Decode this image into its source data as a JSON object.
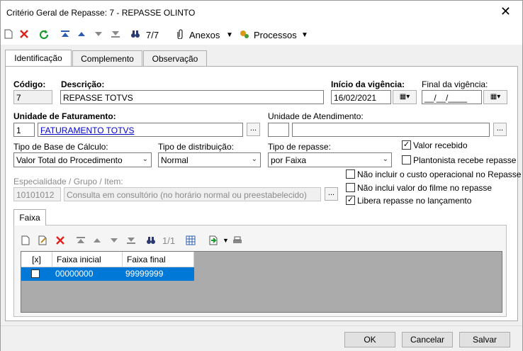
{
  "window": {
    "title": "Critério Geral de Repasse: 7 - REPASSE OLINTO"
  },
  "toolbar": {
    "record_position": "7/7",
    "anexos_label": "Anexos",
    "processos_label": "Processos"
  },
  "tabs": [
    "Identificação",
    "Complemento",
    "Observação"
  ],
  "form": {
    "codigo_label": "Código:",
    "codigo_value": "7",
    "descricao_label": "Descrição:",
    "descricao_value": "REPASSE TOTVS",
    "inicio_label": "Início da vigência:",
    "inicio_value": "16/02/2021",
    "final_label": "Final da vigência:",
    "final_value": "__/__/____",
    "unid_fat_label": "Unidade de Faturamento:",
    "unid_fat_code": "1",
    "unid_fat_name": "FATURAMENTO TOTVS",
    "unid_atend_label": "Unidade de Atendimento:",
    "unid_atend_code": "",
    "unid_atend_name": "",
    "tipo_base_label": "Tipo de Base de Cálculo:",
    "tipo_base_value": "Valor Total do Procedimento",
    "tipo_dist_label": "Tipo de distribuição:",
    "tipo_dist_value": "Normal",
    "tipo_rep_label": "Tipo de repasse:",
    "tipo_rep_value": "por Faixa",
    "espec_label": "Especialidade / Grupo / Item:",
    "espec_code": "10101012",
    "espec_desc": "Consulta em consultório (no horário normal ou preestabelecido)",
    "dots": "...",
    "chk_valor_recebido": "Valor recebido",
    "chk_plantonista": "Plantonista recebe repasse",
    "chk_nao_incluir_custo": "Não incluir o custo operacional no Repasse",
    "chk_nao_incluir_filme": "Não inclui valor do filme no repasse",
    "chk_libera": "Libera repasse no lançamento"
  },
  "faixa": {
    "tab_label": "Faixa",
    "record_position": "1/1",
    "headers": [
      "[x]",
      "Faixa inicial",
      "Faixa final"
    ],
    "rows": [
      {
        "inicial": "00000000",
        "final": "99999999"
      }
    ]
  },
  "buttons": {
    "ok": "OK",
    "cancel": "Cancelar",
    "save": "Salvar"
  },
  "icons": {
    "checkmark": "✓",
    "close": "✕",
    "binoculars": "binoculars-icon"
  }
}
